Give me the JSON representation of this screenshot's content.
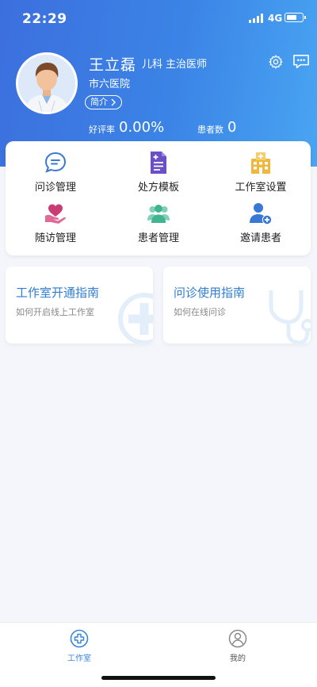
{
  "status_bar": {
    "time": "22:29",
    "network": "4G"
  },
  "profile": {
    "name": "王立磊",
    "department": "儿科",
    "title": "主治医师",
    "hospital": "市六医院",
    "intro_label": "简介",
    "rating_label": "好评率",
    "rating_value": "0.00%",
    "patients_label": "患者数",
    "patients_value": "0"
  },
  "menu": [
    {
      "label": "问诊管理",
      "icon": "chat-bubble-icon",
      "color": "#3a78d6"
    },
    {
      "label": "处方模板",
      "icon": "document-plus-icon",
      "color": "#6a4fc7"
    },
    {
      "label": "工作室设置",
      "icon": "hospital-building-icon",
      "color": "#f0b73d"
    },
    {
      "label": "随访管理",
      "icon": "heart-hand-icon",
      "color": "#c93d74"
    },
    {
      "label": "患者管理",
      "icon": "user-group-icon",
      "color": "#3fb48f"
    },
    {
      "label": "邀请患者",
      "icon": "invite-user-icon",
      "color": "#3a78d6"
    }
  ],
  "guides": [
    {
      "title": "工作室开通指南",
      "subtitle": "如何开启线上工作室"
    },
    {
      "title": "问诊使用指南",
      "subtitle": "如何在线问诊"
    }
  ],
  "tabs": [
    {
      "label": "工作室",
      "active": true
    },
    {
      "label": "我的",
      "active": false
    }
  ],
  "colors": {
    "header_start": "#3c6fde",
    "header_end": "#49a5f2",
    "accent": "#2f7dd1",
    "background": "#f4f6fb"
  }
}
